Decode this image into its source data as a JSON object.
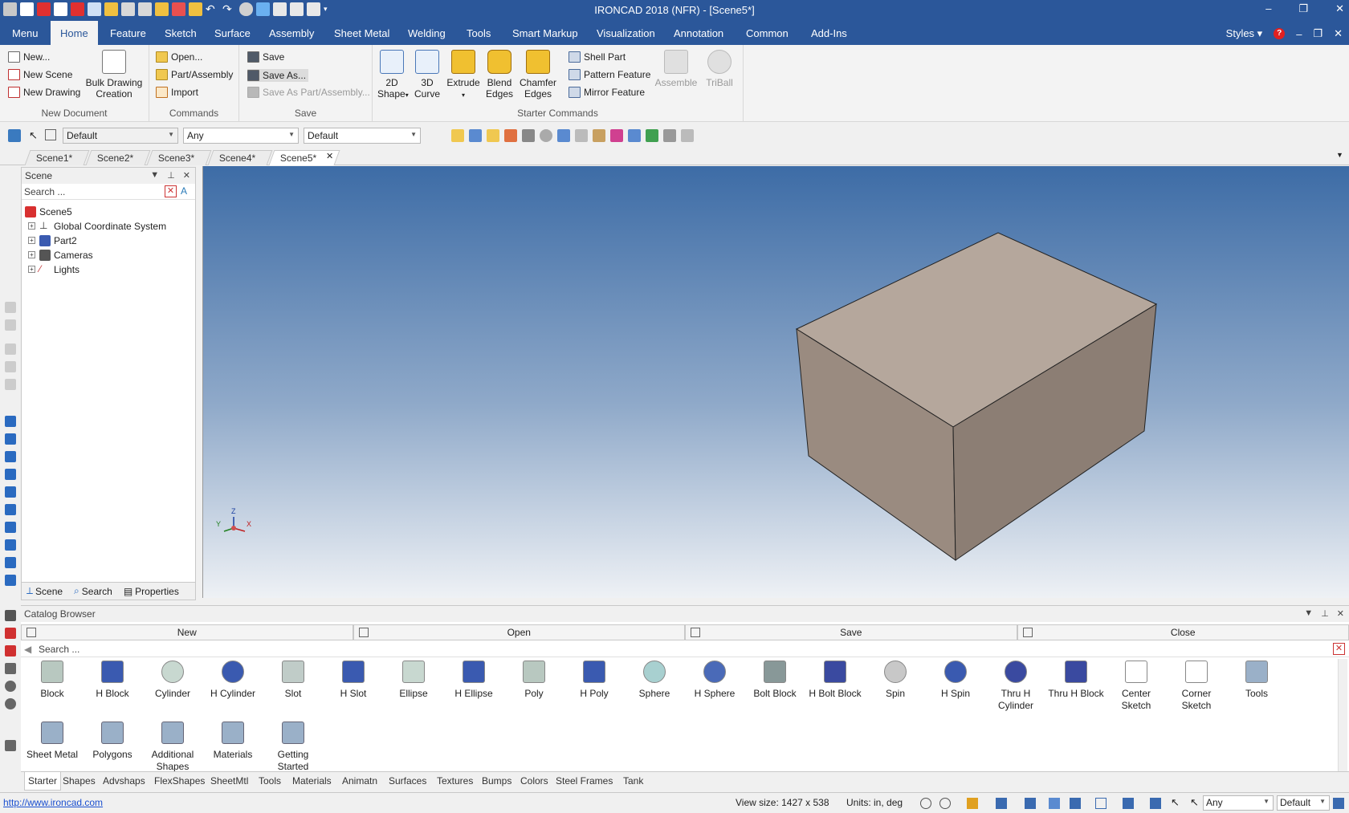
{
  "app": {
    "title": "IRONCAD 2018 (NFR) - [Scene5*]",
    "window_controls": [
      "–",
      "❐",
      "✕"
    ]
  },
  "menubar": {
    "tabs": [
      {
        "label": "Menu",
        "active": false
      },
      {
        "label": "Home",
        "active": true
      },
      {
        "label": "Feature",
        "active": false
      },
      {
        "label": "Sketch",
        "active": false
      },
      {
        "label": "Surface",
        "active": false
      },
      {
        "label": "Assembly",
        "active": false
      },
      {
        "label": "Sheet Metal",
        "active": false
      },
      {
        "label": "Welding",
        "active": false
      },
      {
        "label": "Tools",
        "active": false
      },
      {
        "label": "Smart Markup",
        "active": false
      },
      {
        "label": "Visualization",
        "active": false
      },
      {
        "label": "Annotation",
        "active": false
      },
      {
        "label": "Common",
        "active": false
      },
      {
        "label": "Add-Ins",
        "active": false
      }
    ],
    "styles_label": "Styles",
    "help_icon": "?"
  },
  "ribbon": {
    "new_document": {
      "label": "New Document",
      "new": "New...",
      "new_scene": "New Scene",
      "new_drawing": "New Drawing",
      "bulk_line1": "Bulk Drawing",
      "bulk_line2": "Creation"
    },
    "commands": {
      "label": "Commands",
      "open": "Open...",
      "part_assembly": "Part/Assembly",
      "import": "Import"
    },
    "save": {
      "label": "Save",
      "save": "Save",
      "save_as": "Save As...",
      "save_as_part": "Save As Part/Assembly..."
    },
    "starter": {
      "label": "Starter Commands",
      "shape2d_1": "2D",
      "shape2d_2": "Shape",
      "curve3d_1": "3D",
      "curve3d_2": "Curve",
      "extrude": "Extrude",
      "blend_1": "Blend",
      "blend_2": "Edges",
      "chamfer_1": "Chamfer",
      "chamfer_2": "Edges",
      "shell_part": "Shell Part",
      "pattern_feature": "Pattern Feature",
      "mirror_feature": "Mirror Feature",
      "assemble": "Assemble",
      "triball": "TriBall"
    }
  },
  "toolbar": {
    "combo1": "Default",
    "combo2": "Any",
    "combo3": "Default"
  },
  "doc_tabs": [
    "Scene1*",
    "Scene2*",
    "Scene3*",
    "Scene4*",
    "Scene5*"
  ],
  "scene_panel": {
    "title": "Scene",
    "search_placeholder": "Search ...",
    "tree": [
      "Scene5",
      "Global Coordinate System",
      "Part2",
      "Cameras",
      "Lights"
    ],
    "tabs": [
      "Scene",
      "Search",
      "Properties"
    ]
  },
  "viewport": {
    "axis_labels": {
      "z": "Z",
      "x": "X",
      "y": "Y"
    }
  },
  "catalog": {
    "title": "Catalog Browser",
    "buttons": [
      "New",
      "Open",
      "Save",
      "Close"
    ],
    "search_placeholder": "Search ...",
    "items_row1": [
      "Block",
      "H Block",
      "Cylinder",
      "H Cylinder",
      "Slot",
      "H Slot",
      "Ellipse",
      "H Ellipse",
      "Poly",
      "H Poly",
      "Sphere",
      "H Sphere",
      "Bolt Block",
      "H Bolt Block",
      "Spin",
      "H Spin",
      "Thru H Cylinder",
      "Thru H Block",
      "Center Sketch",
      "Corner Sketch",
      "Tools"
    ],
    "items_row2": [
      "Sheet Metal",
      "Polygons",
      "Additional Shapes",
      "Materials",
      "Getting Started"
    ],
    "tabs": [
      "Starter",
      "Shapes",
      "Advshaps",
      "FlexShapes",
      "SheetMtl",
      "Tools",
      "Materials",
      "Animatn",
      "Surfaces",
      "Textures",
      "Bumps",
      "Colors",
      "Steel Frames",
      "Tank"
    ]
  },
  "status": {
    "link": "http://www.ironcad.com",
    "view_size": "View size: 1427 x  538",
    "units": "Units: in, deg",
    "combo_any": "Any",
    "combo_default": "Default"
  },
  "colors": {
    "title_bar": "#2b579a",
    "block_top": "#b5a79c",
    "block_left": "#9a8b80",
    "block_right": "#8c7e74"
  }
}
